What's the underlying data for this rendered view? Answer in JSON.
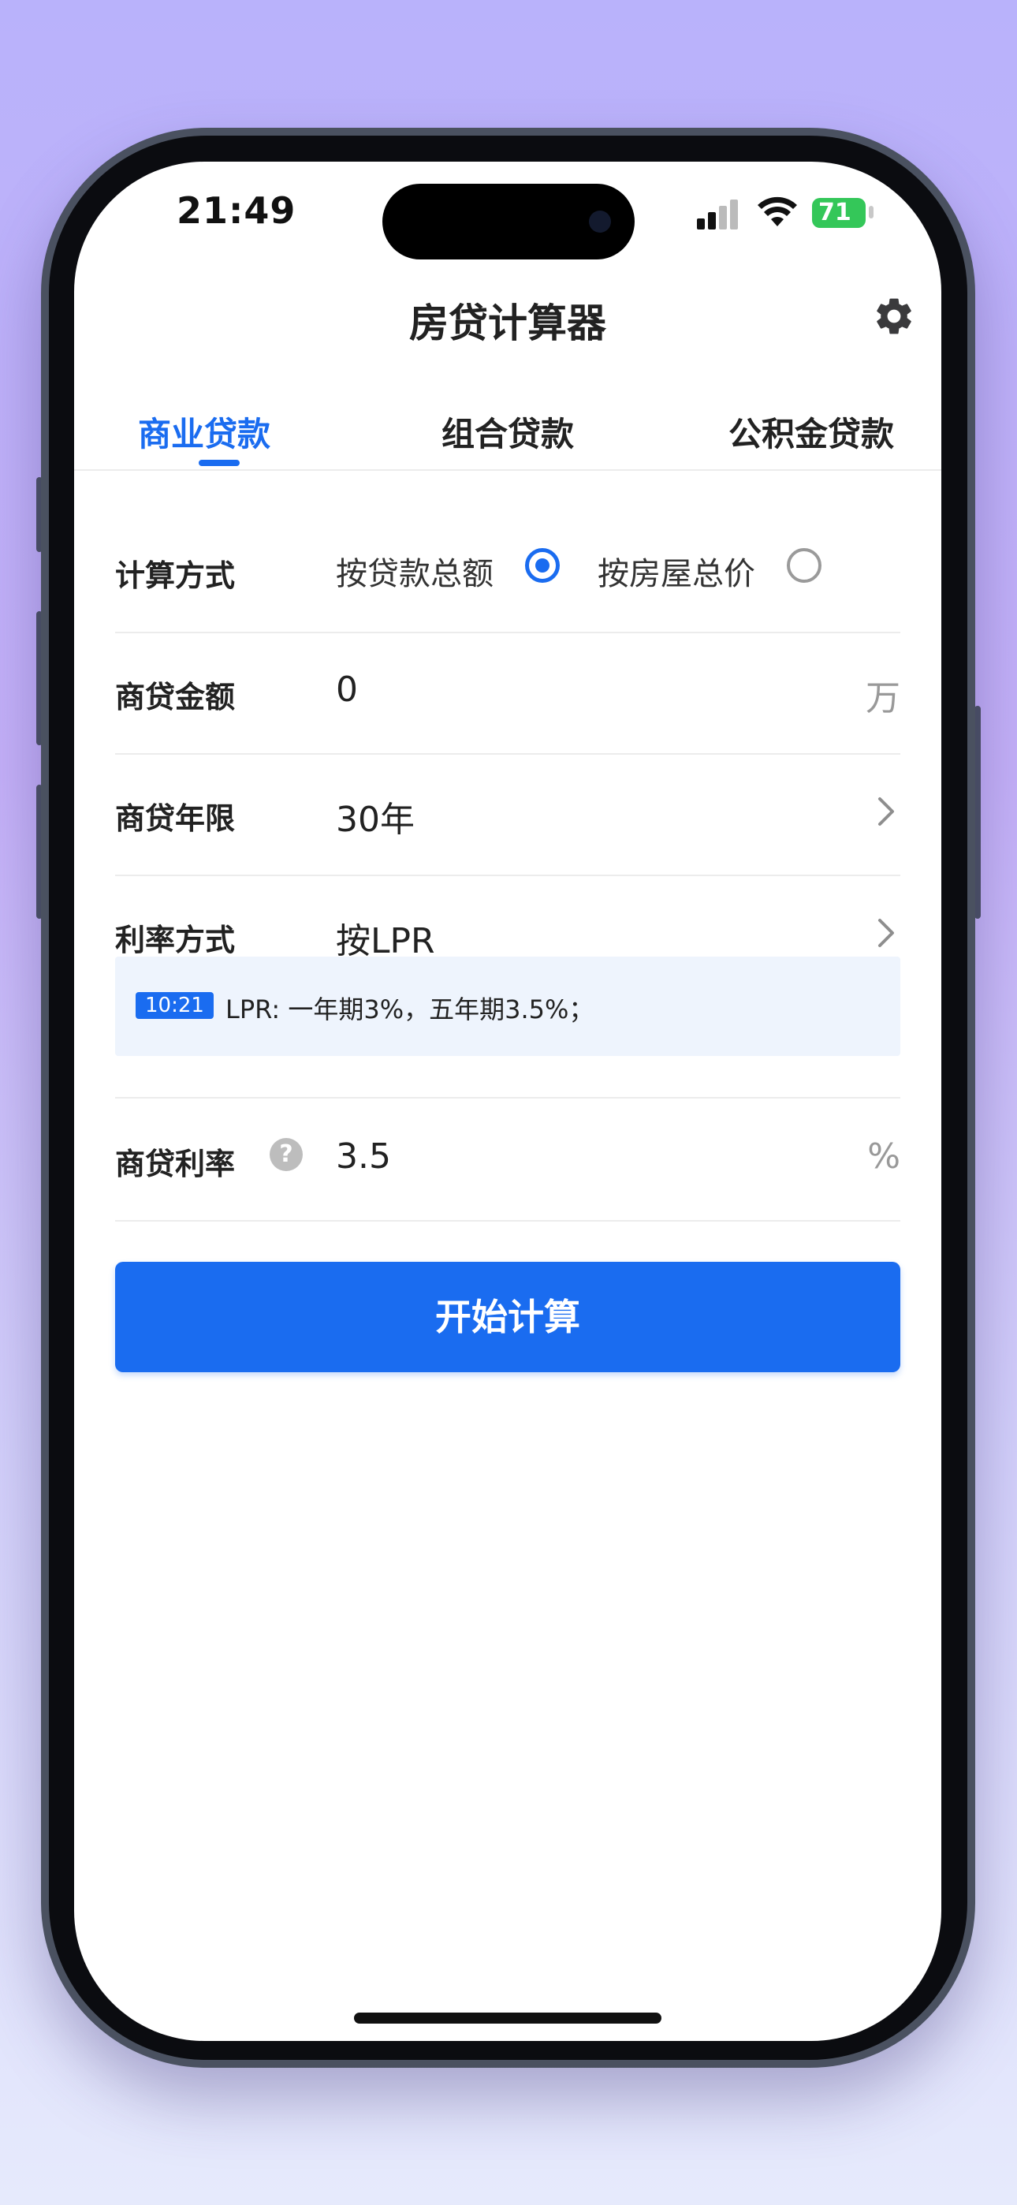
{
  "status_bar": {
    "time": "21:49",
    "battery": "71",
    "battery_color": "#34c759"
  },
  "header": {
    "title": "房贷计算器",
    "settings_icon": "gear-icon"
  },
  "tabs": [
    {
      "label": "商业贷款",
      "active": true
    },
    {
      "label": "组合贷款",
      "active": false
    },
    {
      "label": "公积金贷款",
      "active": false
    }
  ],
  "form": {
    "calc_method": {
      "label": "计算方式",
      "options": [
        {
          "label": "按贷款总额",
          "selected": true
        },
        {
          "label": "按房屋总价",
          "selected": false
        }
      ]
    },
    "loan_amount": {
      "label": "商贷金额",
      "value": "0",
      "unit": "万"
    },
    "loan_term": {
      "label": "商贷年限",
      "value": "30年"
    },
    "rate_method": {
      "label": "利率方式",
      "value": "按LPR"
    },
    "lpr_notice": {
      "tag": "10:21",
      "text": "LPR: 一年期3%，五年期3.5%；"
    },
    "loan_rate": {
      "label": "商贷利率",
      "help_icon": "?",
      "value": "3.5",
      "unit": "%"
    }
  },
  "actions": {
    "calculate_label": "开始计算"
  },
  "colors": {
    "accent": "#1a6cf0",
    "notice_bg": "#eef4fd"
  }
}
